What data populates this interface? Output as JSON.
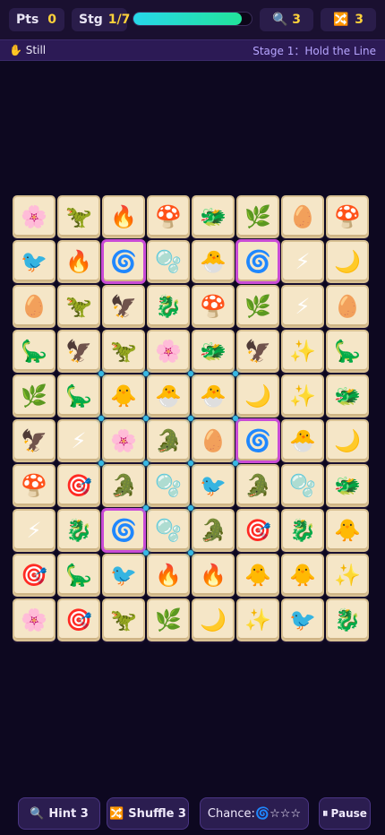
{
  "hud": {
    "points_label": "Pts",
    "points_value": "0",
    "stage_label": "Stg",
    "stage_value": "1/7",
    "progress_fraction": 0.92,
    "hint_icon": "🔍",
    "hint_count": "3",
    "shuffle_icon": "🔀",
    "shuffle_count": "3"
  },
  "status": {
    "state_icon": "✋",
    "state_text": "Still",
    "stage_title": "Stage 1：Hold the Line"
  },
  "board": {
    "rows": [
      [
        "🌸",
        "🦖",
        "🔥",
        "🍄",
        "🐲",
        "🌿",
        "🥚",
        "🍄"
      ],
      [
        "🐦",
        "🔥",
        "🌀",
        "🫧",
        "🐣",
        "🌀",
        "⚡",
        "🌙"
      ],
      [
        "🥚",
        "🦖",
        "🦅",
        "🐉",
        "🍄",
        "🌿",
        "⚡",
        "🥚"
      ],
      [
        "🦕",
        "🦅",
        "🦖",
        "🌸",
        "🐲",
        "🦅",
        "✨",
        "🦕"
      ],
      [
        "🌿",
        "🦕",
        "🐥",
        "🐣",
        "🐣",
        "🌙",
        "✨",
        "🐲"
      ],
      [
        "🦅",
        "⚡",
        "🌸",
        "🐊",
        "🥚",
        "🌀",
        "🐣",
        "🌙"
      ],
      [
        "🍄",
        "🎯",
        "🐊",
        "🫧",
        "🐦",
        "🐊",
        "🫧",
        "🐲"
      ],
      [
        "⚡",
        "🐉",
        "🌀",
        "🫧",
        "🐊",
        "🎯",
        "🐉",
        "🐥"
      ],
      [
        "🎯",
        "🦕",
        "🐦",
        "🔥",
        "🔥",
        "🐥",
        "🐥",
        "✨"
      ],
      [
        "🌸",
        "🎯",
        "🦖",
        "🌿",
        "🌙",
        "✨",
        "🐦",
        "🐉"
      ]
    ],
    "selected": [
      [
        1,
        2
      ],
      [
        1,
        5
      ],
      [
        5,
        5
      ],
      [
        7,
        2
      ]
    ]
  },
  "controls": {
    "hint_icon": "🔍",
    "hint_label": "Hint 3",
    "shuffle_icon": "🔀",
    "shuffle_label": "Shuffle 3",
    "chance_label": "Chance:🌀☆☆☆",
    "pause_icon": "⏸",
    "pause_label": "Pause"
  },
  "colors": {
    "background": "#0d0820",
    "tile": "#f5e6c7",
    "selected_border": "#c94bd6",
    "accent_value": "#ffd23a",
    "stage_title": "#b7a6ff"
  }
}
